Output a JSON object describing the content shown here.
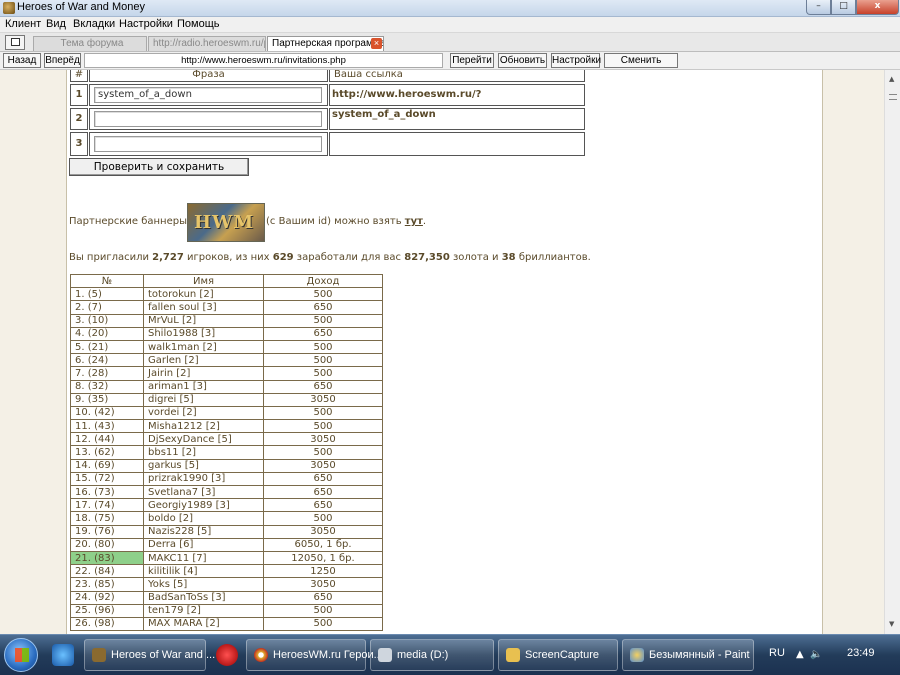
{
  "window": {
    "title": "Heroes of War and Money",
    "min": "–",
    "max": "□",
    "close": "x"
  },
  "menu": [
    "Клиент",
    "Вид",
    "Вкладки",
    "Настройки",
    "Помощь"
  ],
  "tabs": [
    {
      "label": "Тема форума"
    },
    {
      "label": "http://radio.heroeswm.ru/pl..."
    },
    {
      "label": "Партнерская программа"
    }
  ],
  "nav": {
    "back": "Назад",
    "forward": "Вперёд",
    "url": "http://www.heroeswm.ru/invitations.php",
    "go": "Перейти",
    "refresh": "Обновить",
    "settings": "Настройки",
    "switch_player": "Сменить игрока"
  },
  "phrases": {
    "headers": {
      "num": "#",
      "phrase": "Фраза",
      "link": "Ваша ссылка"
    },
    "rows": [
      {
        "num": "1",
        "phrase": "system_of_a_down",
        "link": "http://www.heroeswm.ru/?system_of_a_down"
      },
      {
        "num": "2",
        "phrase": "",
        "link": ""
      },
      {
        "num": "3",
        "phrase": "",
        "link": ""
      }
    ],
    "save_button": "Проверить и сохранить"
  },
  "banners": {
    "prefix": "Партнерские баннеры",
    "banner_text": "HWM",
    "suffix": "(с Вашим id) можно взять",
    "link": "тут",
    "end": "."
  },
  "stats": {
    "t1": "Вы пригласили ",
    "invited": "2,727",
    "t2": " игроков, из них ",
    "earners": "629",
    "t3": " заработали для вас ",
    "gold": "827,350",
    "t4": " золота и ",
    "diamonds": "38",
    "t5": " бриллиантов."
  },
  "referrals": {
    "headers": {
      "num": "№",
      "name": "Имя",
      "income": "Доход"
    },
    "rows": [
      {
        "num": "1. (5)",
        "name": "totorokun [2]",
        "income": "500"
      },
      {
        "num": "2. (7)",
        "name": "fallen soul [3]",
        "income": "650"
      },
      {
        "num": "3. (10)",
        "name": "MrVuL [2]",
        "income": "500"
      },
      {
        "num": "4. (20)",
        "name": "Shilo1988 [3]",
        "income": "650"
      },
      {
        "num": "5. (21)",
        "name": "walk1man [2]",
        "income": "500"
      },
      {
        "num": "6. (24)",
        "name": "Garlen [2]",
        "income": "500"
      },
      {
        "num": "7. (28)",
        "name": "Jairin [2]",
        "income": "500"
      },
      {
        "num": "8. (32)",
        "name": "ariman1 [3]",
        "income": "650"
      },
      {
        "num": "9. (35)",
        "name": "digrei [5]",
        "income": "3050"
      },
      {
        "num": "10. (42)",
        "name": "vordei [2]",
        "income": "500"
      },
      {
        "num": "11. (43)",
        "name": "Misha1212 [2]",
        "income": "500"
      },
      {
        "num": "12. (44)",
        "name": "DjSexyDance [5]",
        "income": "3050"
      },
      {
        "num": "13. (62)",
        "name": "bbs11 [2]",
        "income": "500"
      },
      {
        "num": "14. (69)",
        "name": "garkus [5]",
        "income": "3050"
      },
      {
        "num": "15. (72)",
        "name": "prizrak1990 [3]",
        "income": "650"
      },
      {
        "num": "16. (73)",
        "name": "Svetlana7 [3]",
        "income": "650"
      },
      {
        "num": "17. (74)",
        "name": "Georgiy1989 [3]",
        "income": "650"
      },
      {
        "num": "18. (75)",
        "name": "boldo [2]",
        "income": "500"
      },
      {
        "num": "19. (76)",
        "name": "Nazis228 [5]",
        "income": "3050"
      },
      {
        "num": "20. (80)",
        "name": "Derra [6]",
        "income": "6050, 1 бр."
      },
      {
        "num": "21. (83)",
        "name": "MAKC11 [7]",
        "income": "12050, 1 бр.",
        "highlight": true
      },
      {
        "num": "22. (84)",
        "name": "kilitilik [4]",
        "income": "1250"
      },
      {
        "num": "23. (85)",
        "name": "Yoks [5]",
        "income": "3050"
      },
      {
        "num": "24. (92)",
        "name": "BadSanToSs [3]",
        "income": "650"
      },
      {
        "num": "25. (96)",
        "name": "ten179 [2]",
        "income": "500"
      },
      {
        "num": "26. (98)",
        "name": "MAX MARA [2]",
        "income": "500"
      }
    ]
  },
  "taskbar": {
    "items": [
      {
        "label": "Heroes of War and ...",
        "color": "#8a6a30"
      },
      {
        "label": "HeroesWM.ru Герои...",
        "color": "#e0b030"
      },
      {
        "label": "media (D:)",
        "color": "#d0d0d0"
      },
      {
        "label": "ScreenCapture",
        "color": "#e8c050"
      },
      {
        "label": "Безымянный - Paint",
        "color": "#6aa0e0"
      }
    ],
    "lang": "RU",
    "time": "23:49"
  }
}
